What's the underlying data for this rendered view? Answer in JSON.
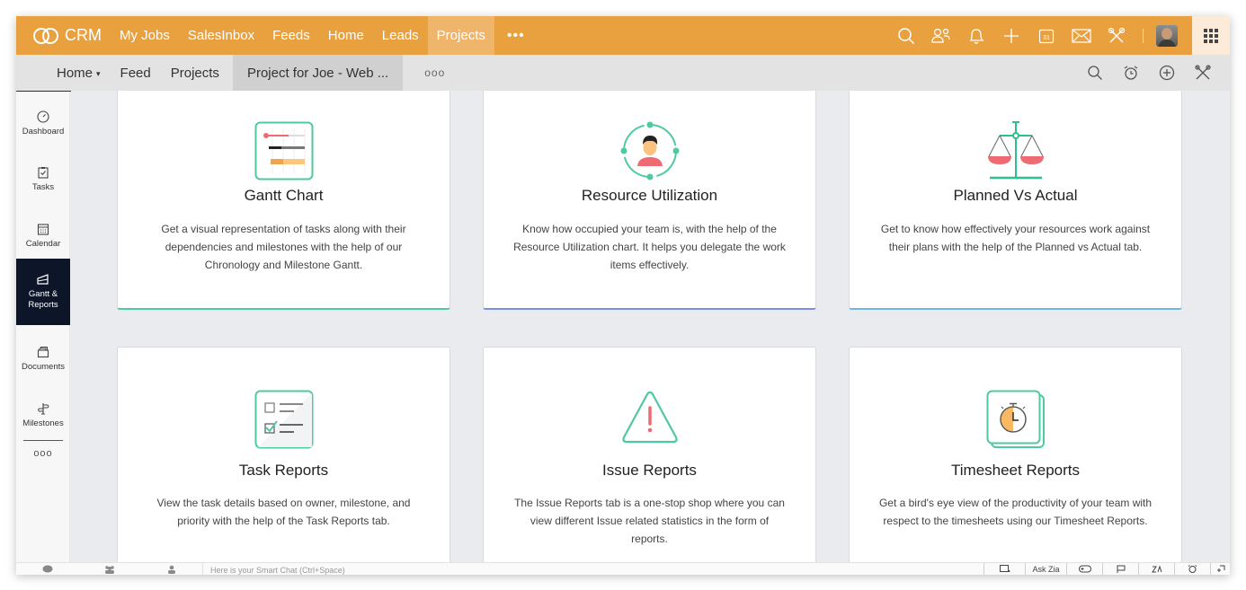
{
  "topbar": {
    "brand": "CRM",
    "nav": [
      {
        "label": "My Jobs",
        "active": false
      },
      {
        "label": "SalesInbox",
        "active": false
      },
      {
        "label": "Feeds",
        "active": false
      },
      {
        "label": "Home",
        "active": false
      },
      {
        "label": "Leads",
        "active": false
      },
      {
        "label": "Projects",
        "active": true
      }
    ],
    "more_label": "•••",
    "icons": [
      "search-icon",
      "contacts-icon",
      "bell-icon",
      "plus-icon",
      "calendar-icon",
      "mail-icon",
      "tools-icon"
    ],
    "calendar_day": "31",
    "accent_color": "#e9a13f"
  },
  "subbar": {
    "items": [
      {
        "label": "Home",
        "has_caret": true
      },
      {
        "label": "Feed"
      },
      {
        "label": "Projects"
      },
      {
        "label": "Project for Joe - Web ...",
        "active": true
      }
    ],
    "caret": "▾",
    "more_label": "ooo",
    "icons": [
      "search-icon",
      "timer-icon",
      "add-circle-icon",
      "settings-tools-icon"
    ]
  },
  "sidebar": {
    "items": [
      {
        "label": "Dashboard",
        "icon": "dashboard-icon"
      },
      {
        "label": "Tasks",
        "icon": "clipboard-icon"
      },
      {
        "label": "Calendar",
        "icon": "calendar-icon"
      },
      {
        "label_line1": "Gantt &",
        "label_line2": "Reports",
        "icon": "gantt-icon",
        "active": true
      },
      {
        "label": "Documents",
        "icon": "documents-icon"
      },
      {
        "label": "Milestones",
        "icon": "signpost-icon"
      }
    ],
    "more_label": "ooo"
  },
  "cards": [
    {
      "title": "Gantt Chart",
      "description": "Get a visual representation of tasks along with their dependencies and milestones with the help of our Chronology and Milestone Gantt.",
      "icon": "gantt-chart-icon"
    },
    {
      "title": "Resource Utilization",
      "description": "Know how occupied your team is, with the help of the Resource Utilization chart. It helps you delegate the work items effectively.",
      "icon": "resource-user-icon"
    },
    {
      "title": "Planned Vs Actual",
      "description": "Get to know how effectively your resources work against their plans with the help of the Planned vs Actual tab.",
      "icon": "balance-scale-icon"
    },
    {
      "title": "Task Reports",
      "description": "View the task details based on owner, milestone, and priority with the help of the Task Reports tab.",
      "icon": "checklist-icon"
    },
    {
      "title": "Issue Reports",
      "description": "The Issue Reports tab is a one-stop shop where you can view different Issue related statistics in the form of reports.",
      "icon": "warning-icon"
    },
    {
      "title": "Timesheet Reports",
      "description": "Get a bird's eye view of the productivity of your team with respect to the timesheets using our Timesheet Reports.",
      "icon": "stopwatch-icon"
    }
  ],
  "bottombar": {
    "chat_placeholder": "Here is your Smart Chat (Ctrl+Space)",
    "ask_zia": "Ask Zia"
  }
}
